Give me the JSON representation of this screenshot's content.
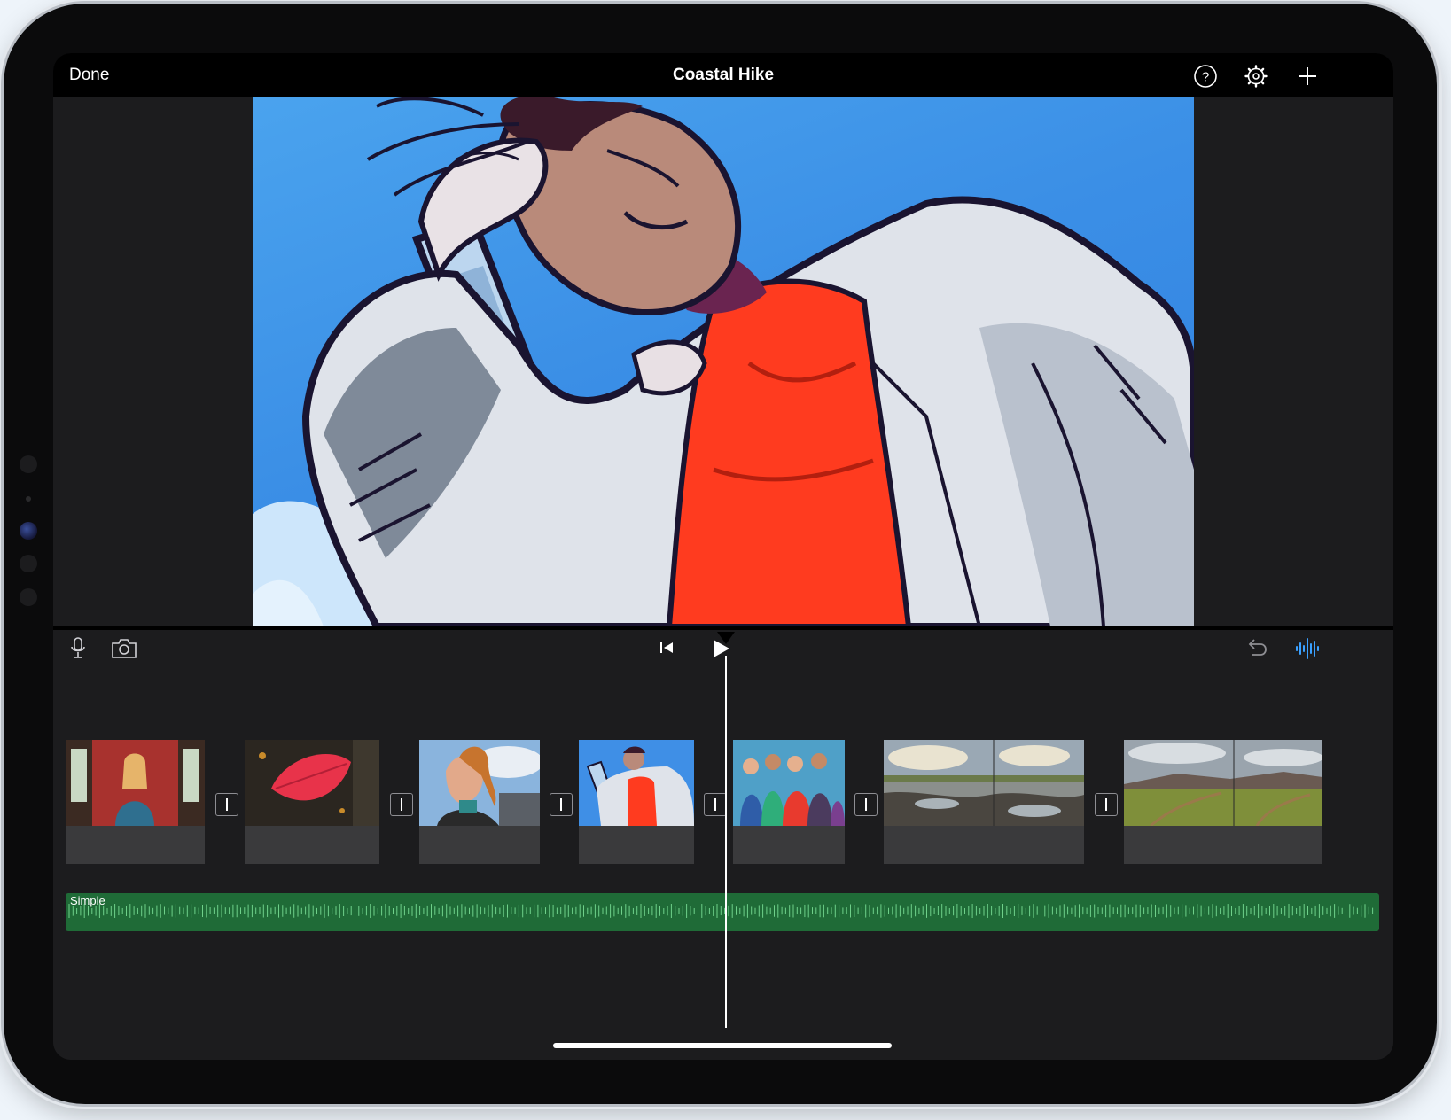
{
  "header": {
    "done_label": "Done",
    "title": "Coastal Hike"
  },
  "icons": {
    "help": "help-circle-icon",
    "settings": "gear-icon",
    "add": "plus-icon",
    "mic": "microphone-icon",
    "camera": "camera-icon",
    "skip_back": "skip-to-start-icon",
    "play": "play-icon",
    "undo": "undo-icon",
    "audio": "audio-waveform-icon"
  },
  "timeline": {
    "clips": [
      {
        "name": "woman-red-room"
      },
      {
        "name": "red-leaf"
      },
      {
        "name": "woman-profile"
      },
      {
        "name": "woman-ladder"
      },
      {
        "name": "group-friends"
      },
      {
        "name": "rocky-shore"
      },
      {
        "name": "green-field"
      }
    ],
    "audio_track_label": "Simple"
  },
  "colors": {
    "accent": "#3aa0ff",
    "audio_track": "#1f6b37",
    "background": "#1c1c1e"
  }
}
